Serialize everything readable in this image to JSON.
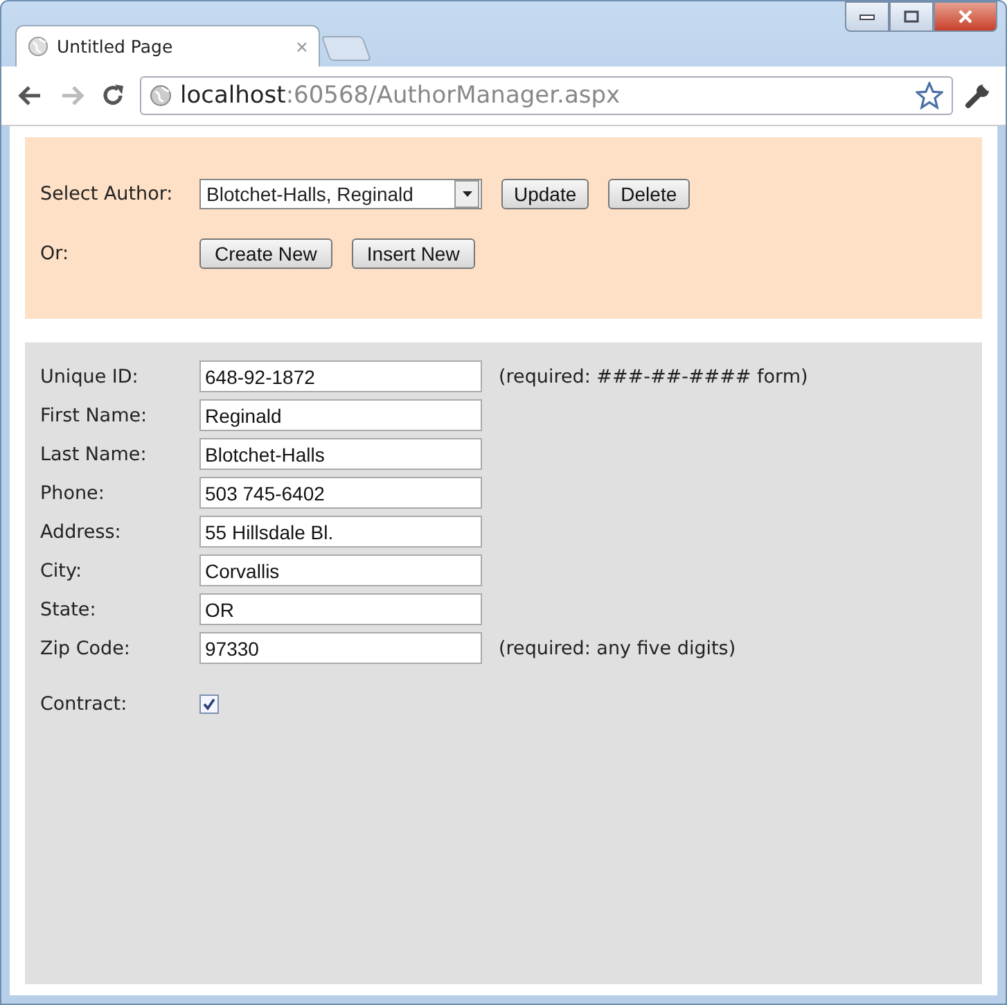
{
  "browser": {
    "tab_title": "Untitled Page",
    "url_host": "localhost",
    "url_rest": ":60568/AuthorManager.aspx"
  },
  "selector": {
    "label": "Select Author:",
    "selected_author": "Blotchet-Halls, Reginald",
    "buttons": [
      "Update",
      "Delete"
    ],
    "or_label": "Or:",
    "new_buttons": [
      "Create New",
      "Insert New"
    ]
  },
  "fields": [
    {
      "label": "Unique ID:",
      "value": "648-92-1872",
      "hint": "(required: ###-##-#### form)"
    },
    {
      "label": "First Name:",
      "value": "Reginald"
    },
    {
      "label": "Last Name:",
      "value": "Blotchet-Halls"
    },
    {
      "label": "Phone:",
      "value": "503 745-6402"
    },
    {
      "label": "Address:",
      "value": "55 Hillsdale Bl."
    },
    {
      "label": "City:",
      "value": "Corvallis"
    },
    {
      "label": "State:",
      "value": "OR"
    },
    {
      "label": "Zip Code:",
      "value": "97330",
      "hint": "(required: any five digits)"
    }
  ],
  "contract": {
    "label": "Contract:",
    "checked": true
  }
}
